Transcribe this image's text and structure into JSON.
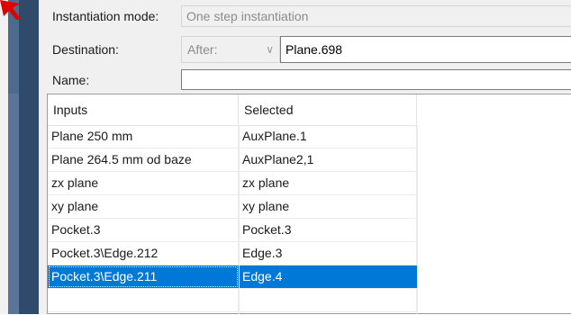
{
  "form": {
    "mode_label": "Instantiation mode:",
    "mode_value": "One step instantiation",
    "destination_label": "Destination:",
    "destination_position": "After:",
    "destination_value": "Plane.698",
    "name_label": "Name:",
    "name_value": ""
  },
  "table": {
    "headers": [
      "Inputs",
      "Selected"
    ],
    "rows": [
      [
        "Plane 250 mm",
        "AuxPlane.1"
      ],
      [
        "Plane 264.5 mm od baze",
        "AuxPlane2,1"
      ],
      [
        "zx plane",
        "zx plane"
      ],
      [
        "xy plane",
        "xy plane"
      ],
      [
        "Pocket.3",
        "Pocket.3"
      ],
      [
        "Pocket.3\\Edge.212",
        "Edge.3"
      ],
      [
        "Pocket.3\\Edge.211",
        "Edge.4"
      ]
    ],
    "selected_row_index": 6
  },
  "colors": {
    "selection": "#0078d7",
    "sidebar": "#2f4a6b",
    "pointer": "#e00000"
  },
  "icons": {
    "pointer": "red-arrow-icon",
    "dropdown": "chevron-down-icon"
  }
}
